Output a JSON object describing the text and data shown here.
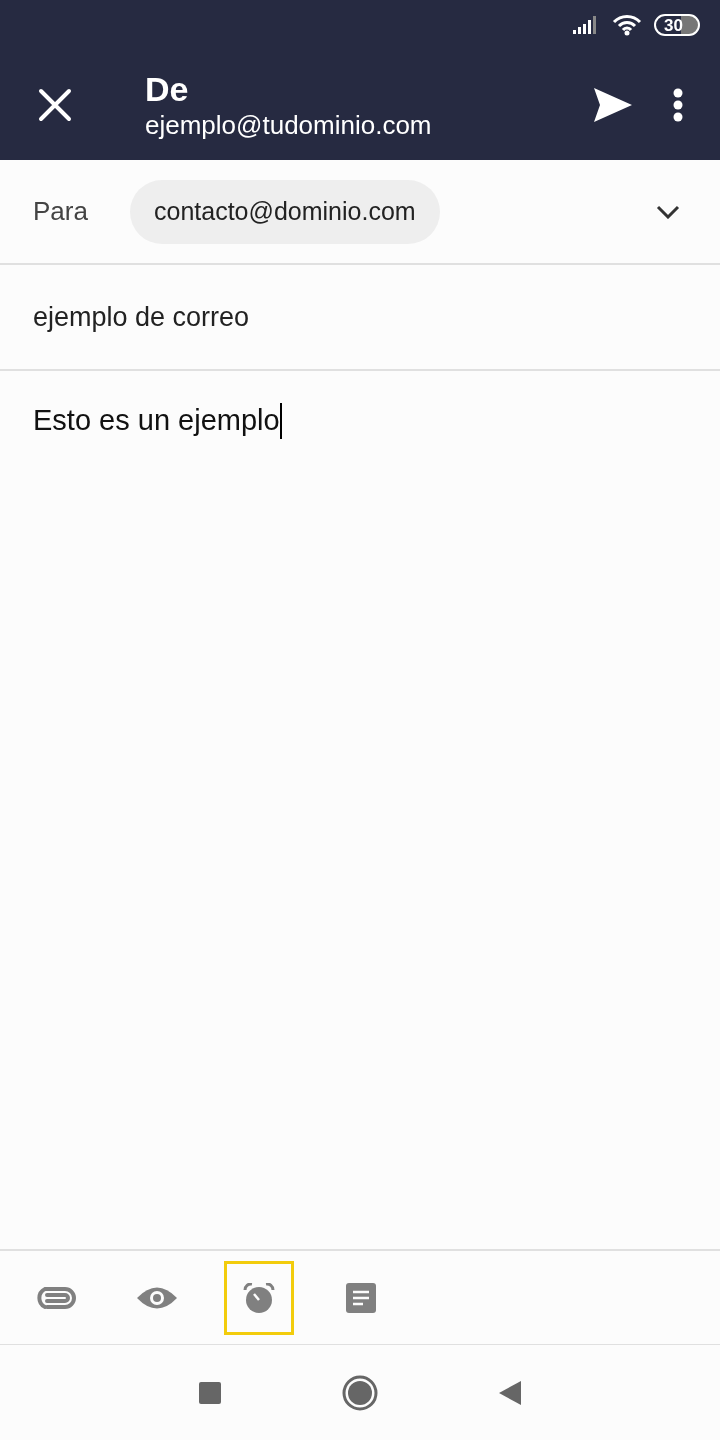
{
  "status_bar": {
    "battery": "30"
  },
  "header": {
    "title": "De",
    "from": "ejemplo@tudominio.com"
  },
  "to": {
    "label": "Para",
    "recipient": "contacto@dominio.com"
  },
  "subject": {
    "value": "ejemplo de correo"
  },
  "body": {
    "value": "Esto es un ejemplo"
  },
  "toolbar": [
    {
      "kind": "attach",
      "highlighted": false
    },
    {
      "kind": "eye",
      "highlighted": false
    },
    {
      "kind": "alarm",
      "highlighted": true
    },
    {
      "kind": "note",
      "highlighted": false
    }
  ]
}
